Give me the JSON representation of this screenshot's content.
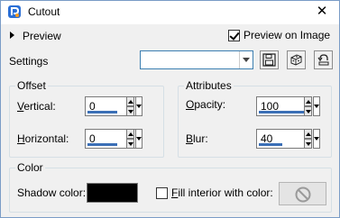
{
  "window": {
    "title": "Cutout",
    "close_glyph": "✕",
    "app_icon": "paint-shop-pro-icon"
  },
  "preview": {
    "toggle_label": "Preview",
    "preview_on_image_label": "Preview on Image",
    "preview_on_image_checked": true
  },
  "settings": {
    "label": "Settings",
    "preset_value": "",
    "save_icon": "save-icon",
    "randomize_icon": "dice-icon",
    "reset_icon": "reset-icon"
  },
  "offset": {
    "legend": "Offset",
    "vertical_label_accel": "V",
    "vertical_label_rest": "ertical:",
    "vertical_value": "0",
    "horizontal_label_accel": "H",
    "horizontal_label_rest": "orizontal:",
    "horizontal_value": "0"
  },
  "attributes": {
    "legend": "Attributes",
    "opacity_label_accel": "O",
    "opacity_label_rest": "pacity:",
    "opacity_value": "100",
    "blur_label_accel": "B",
    "blur_label_rest": "lur:",
    "blur_value": "40"
  },
  "color": {
    "legend": "Color",
    "shadow_label": "Shadow color:",
    "shadow_color": "#000000",
    "fill_interior_label_accel": "F",
    "fill_interior_label_rest": "ill interior with color:",
    "fill_interior_checked": false,
    "fill_icon": "none-icon"
  },
  "colors": {
    "accent": "#3b6fb6",
    "border_focus": "#3c7fb1"
  }
}
